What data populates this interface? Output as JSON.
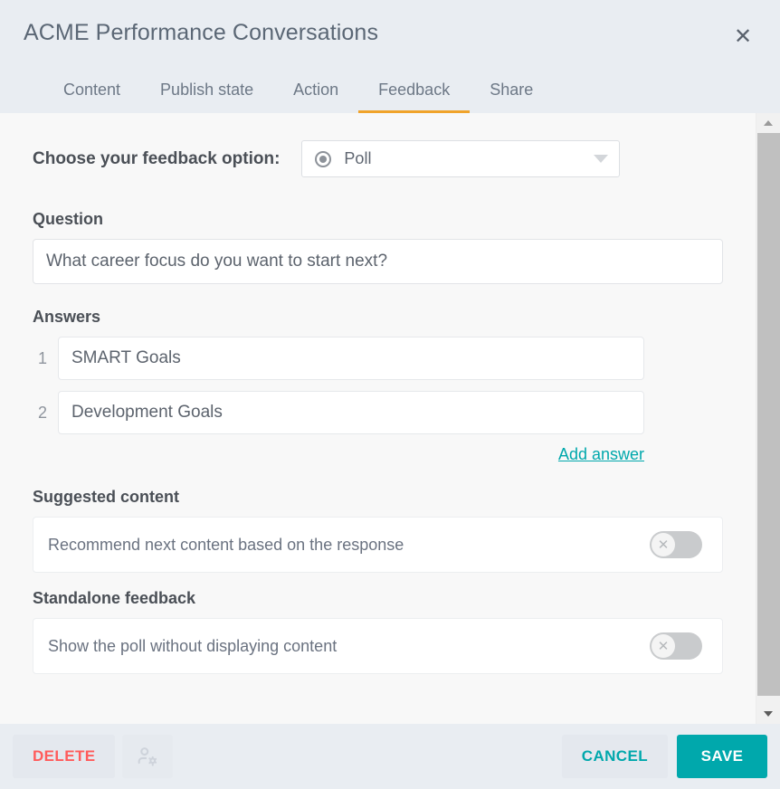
{
  "header": {
    "title": "ACME Performance Conversations",
    "close_label": "✕",
    "tabs": [
      {
        "label": "Content",
        "active": false
      },
      {
        "label": "Publish state",
        "active": false
      },
      {
        "label": "Action",
        "active": false
      },
      {
        "label": "Feedback",
        "active": true
      },
      {
        "label": "Share",
        "active": false
      }
    ],
    "active_tab_color": "#f0a32a"
  },
  "feedback_option": {
    "label": "Choose your feedback option:",
    "selected": "Poll",
    "icon": "radio-selected-icon",
    "chevron": "chevron-down-icon"
  },
  "question": {
    "heading": "Question",
    "value": "What career focus do you want to start next?",
    "placeholder": "Question"
  },
  "answers": {
    "heading": "Answers",
    "items": [
      {
        "index": "1",
        "value": "SMART Goals",
        "placeholder": "Answer"
      },
      {
        "index": "2",
        "value": "Development Goals",
        "placeholder": "Answer"
      }
    ],
    "add_label": "Add answer",
    "add_link_color": "#00a8ac"
  },
  "suggested_content": {
    "heading": "Suggested content",
    "text": "Recommend next content based on the response",
    "toggle_state": "off",
    "toggle_glyph": "✕"
  },
  "standalone_feedback": {
    "heading": "Standalone feedback",
    "text": "Show the poll without displaying content",
    "toggle_state": "off",
    "toggle_glyph": "✕"
  },
  "footer": {
    "delete_label": "DELETE",
    "permissions_icon": "user-settings-icon",
    "cancel_label": "CANCEL",
    "save_label": "SAVE",
    "delete_color": "#ff5b5b",
    "accent_color": "#00a8ac"
  },
  "scrollbar": {
    "up_icon": "scroll-up-arrow-icon",
    "down_icon": "scroll-down-arrow-icon"
  }
}
